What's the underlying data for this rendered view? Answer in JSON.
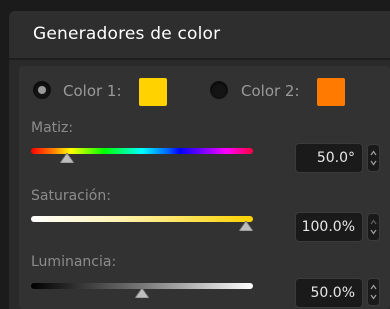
{
  "panel": {
    "title": "Generadores de color"
  },
  "color_generators": [
    {
      "label": "Color 1:",
      "selected": true,
      "swatch": "#FFD200"
    },
    {
      "label": "Color 2:",
      "selected": false,
      "swatch": "#FF7A00"
    }
  ],
  "sliders": [
    {
      "id": "hue",
      "label": "Matiz:",
      "value_text": "50.0°",
      "level": 0.139
    },
    {
      "id": "saturation",
      "label": "Saturación:",
      "value_text": "100.0%",
      "level": 1.0
    },
    {
      "id": "luminance",
      "label": "Luminancia:",
      "value_text": "50.0%",
      "level": 0.5
    }
  ],
  "colors": {
    "background": "#1B1B1B",
    "panel": "#2A2A2A",
    "content": "#323232"
  },
  "icons": {
    "thumb": "triangle-slider-thumb-icon",
    "stepper_up": "chevron-up-icon",
    "stepper_down": "chevron-down-icon"
  }
}
